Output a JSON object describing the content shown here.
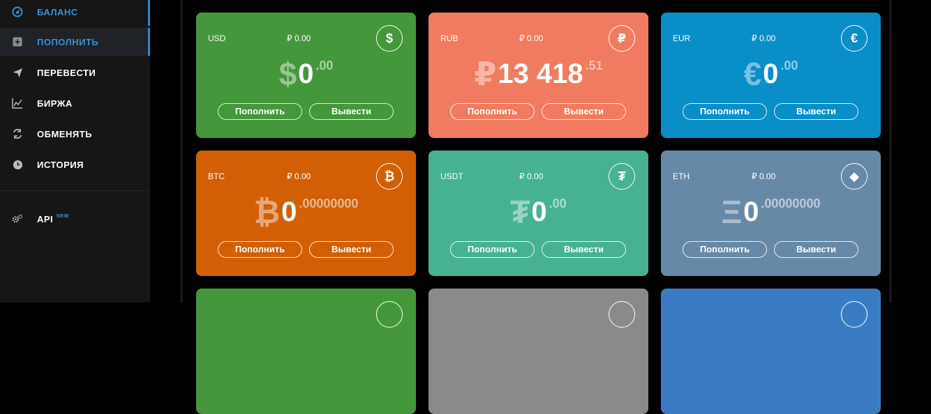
{
  "sidebar": {
    "items": [
      {
        "label": "БАЛАНС"
      },
      {
        "label": "ПОПОЛНИТЬ"
      },
      {
        "label": "ПЕРЕВЕСТИ"
      },
      {
        "label": "БИРЖА"
      },
      {
        "label": "ОБМЕНЯТЬ"
      },
      {
        "label": "ИСТОРИЯ"
      }
    ],
    "api": {
      "label": "API",
      "badge": "NEW"
    }
  },
  "colors": {
    "usd": "#44973b",
    "rub": "#f07b60",
    "eur": "#0a8ec8",
    "btc": "#d25f05",
    "usdt": "#46b292",
    "eth": "#6789a8",
    "accent": "#3a8fd6"
  },
  "cards": [
    {
      "code": "USD",
      "rub": "₽ 0.00",
      "icon": "$",
      "icon_name": "dollar-icon",
      "sym": "$",
      "int": "0",
      "frac": ".00",
      "deposit": "Пополнить",
      "withdraw": "Вывести"
    },
    {
      "code": "RUB",
      "rub": "₽ 0.00",
      "icon": "₽",
      "icon_name": "ruble-icon",
      "sym": "₽",
      "int": "13 418",
      "frac": ".51",
      "deposit": "Пополнить",
      "withdraw": "Вывести"
    },
    {
      "code": "EUR",
      "rub": "₽ 0.00",
      "icon": "€",
      "icon_name": "euro-icon",
      "sym": "€",
      "int": "0",
      "frac": ".00",
      "deposit": "Пополнить",
      "withdraw": "Вывести"
    },
    {
      "code": "BTC",
      "rub": "₽ 0.00",
      "icon": "₿",
      "icon_name": "bitcoin-icon",
      "sym": "₿",
      "int": "0",
      "frac": ".00000000",
      "deposit": "Пополнить",
      "withdraw": "Вывести"
    },
    {
      "code": "USDT",
      "rub": "₽ 0.00",
      "icon": "₮",
      "icon_name": "tether-icon",
      "sym": "₮",
      "int": "0",
      "frac": ".00",
      "deposit": "Пополнить",
      "withdraw": "Вывести"
    },
    {
      "code": "ETH",
      "rub": "₽ 0.00",
      "icon": "◆",
      "icon_name": "ethereum-icon",
      "sym": "Ξ",
      "int": "0",
      "frac": ".00000000",
      "deposit": "Пополнить",
      "withdraw": "Вывести"
    }
  ],
  "partial_cards": [
    {
      "color": "#44973b"
    },
    {
      "color": "#8a8a8a"
    },
    {
      "color": "#3a7cc4"
    }
  ]
}
